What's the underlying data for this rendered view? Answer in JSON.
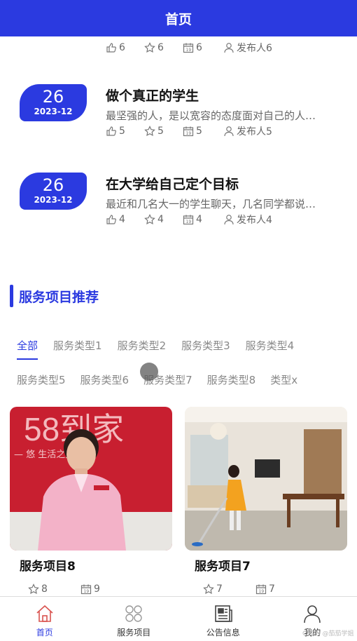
{
  "header": {
    "title": "首页"
  },
  "top_stats": {
    "likes": "6",
    "stars": "6",
    "date": "6",
    "publisher": "发布人6"
  },
  "articles": [
    {
      "day": "26",
      "ym": "2023-12",
      "title": "做个真正的学生",
      "desc": "最坚强的人，是以宽容的态度面对自己的人…",
      "likes": "5",
      "stars": "5",
      "date": "5",
      "publisher": "发布人5"
    },
    {
      "day": "26",
      "ym": "2023-12",
      "title": "在大学给自己定个目标",
      "desc": "最近和几名大一的学生聊天，几名同学都说…",
      "likes": "4",
      "stars": "4",
      "date": "4",
      "publisher": "发布人4"
    }
  ],
  "services": {
    "title": "服务项目推荐",
    "tabs_row1": [
      "全部",
      "服务类型1",
      "服务类型2",
      "服务类型3",
      "服务类型4"
    ],
    "tabs_row2": [
      "服务类型5",
      "服务类型6",
      "服务类型7",
      "服务类型8",
      "类型x"
    ],
    "cards": [
      {
        "title": "服务项目8",
        "stars": "8",
        "date": "9",
        "sign_text": "58到家",
        "sign_sub": "— 悠 生活之美 —"
      },
      {
        "title": "服务项目7",
        "stars": "7",
        "date": "7"
      }
    ]
  },
  "tabbar": [
    {
      "label": "首页",
      "icon": "home-icon"
    },
    {
      "label": "服务项目",
      "icon": "grid-icon"
    },
    {
      "label": "公告信息",
      "icon": "news-icon"
    },
    {
      "label": "我的",
      "icon": "user-icon"
    }
  ],
  "watermark": "CSDN @茄茄学姐",
  "colors": {
    "primary": "#2b3ae0",
    "text_gray": "#666666"
  }
}
